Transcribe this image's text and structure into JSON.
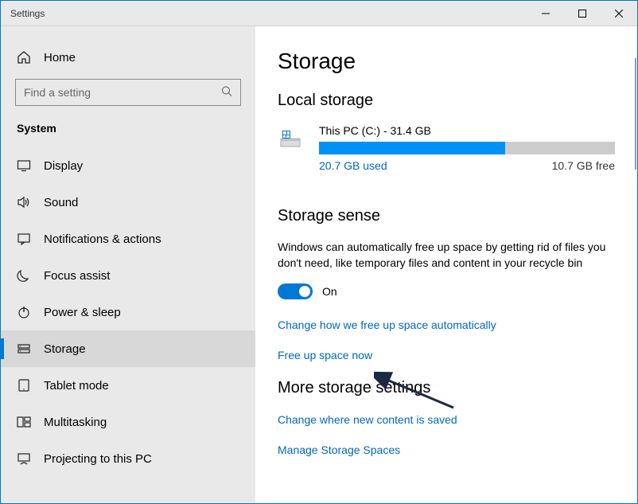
{
  "window": {
    "title": "Settings"
  },
  "sidebar": {
    "home": "Home",
    "search_placeholder": "Find a setting",
    "section": "System",
    "items": [
      {
        "label": "Display"
      },
      {
        "label": "Sound"
      },
      {
        "label": "Notifications & actions"
      },
      {
        "label": "Focus assist"
      },
      {
        "label": "Power & sleep"
      },
      {
        "label": "Storage"
      },
      {
        "label": "Tablet mode"
      },
      {
        "label": "Multitasking"
      },
      {
        "label": "Projecting to this PC"
      }
    ],
    "active_index": 5
  },
  "page": {
    "title": "Storage",
    "local_storage_title": "Local storage",
    "disk": {
      "name": "This PC (C:) - 31.4 GB",
      "used_label": "20.7 GB used",
      "free_label": "10.7 GB free",
      "used_gb": 20.7,
      "total_gb": 31.4,
      "fill_percent": 63
    },
    "storage_sense": {
      "title": "Storage sense",
      "description": "Windows can automatically free up space by getting rid of files you don't need, like temporary files and content in your recycle bin",
      "toggle_state": "On",
      "link_change": "Change how we free up space automatically",
      "link_freeup": "Free up space now"
    },
    "more": {
      "title": "More storage settings",
      "link_newcontent": "Change where new content is saved",
      "link_spaces": "Manage Storage Spaces"
    }
  }
}
